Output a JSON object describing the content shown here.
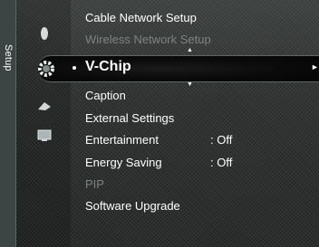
{
  "sidebar": {
    "label": "Setup"
  },
  "menu": {
    "above": [
      {
        "label": "Cable Network Setup",
        "enabled": true
      },
      {
        "label": "Wireless Network Setup",
        "enabled": false
      }
    ],
    "selected": {
      "label": "V-Chip"
    },
    "below": [
      {
        "label": "Caption",
        "value": "",
        "enabled": true
      },
      {
        "label": "External Settings",
        "value": "",
        "enabled": true
      },
      {
        "label": "Entertainment",
        "value": ": Off",
        "enabled": true
      },
      {
        "label": "Energy Saving",
        "value": ": Off",
        "enabled": true
      },
      {
        "label": "PIP",
        "value": "",
        "enabled": false
      },
      {
        "label": "Software Upgrade",
        "value": "",
        "enabled": true
      }
    ]
  },
  "icons": {
    "category_1": "picture-icon",
    "category_setup": "gear-icon",
    "category_3": "satellite-icon",
    "category_4": "input-icon",
    "scroll_up": "triangle-up-icon",
    "scroll_down": "triangle-down-icon",
    "expand": "triangle-right-icon"
  }
}
